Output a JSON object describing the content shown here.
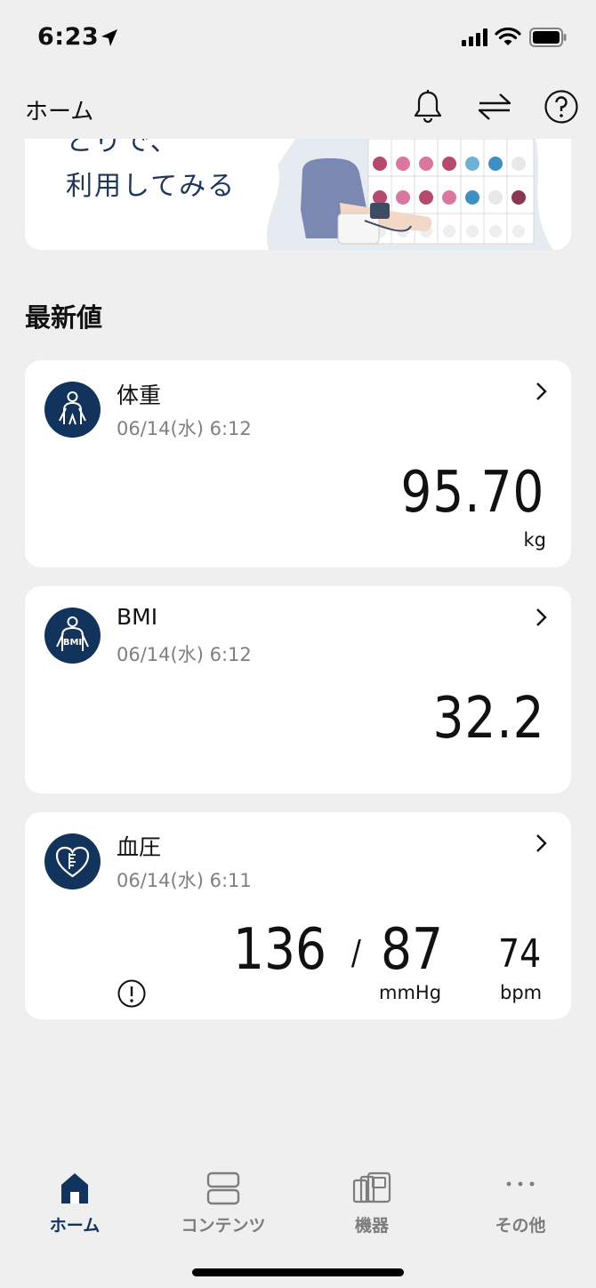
{
  "status": {
    "time": "6:23"
  },
  "header": {
    "title": "ホーム"
  },
  "banner": {
    "line_top": "とりで、",
    "line_main": "利用してみる"
  },
  "section": {
    "title": "最新値"
  },
  "cards": {
    "weight": {
      "title": "体重",
      "date": "06/14(水) 6:12",
      "value": "95.70",
      "unit": "kg",
      "icon": "person-icon"
    },
    "bmi": {
      "title": "BMI",
      "date": "06/14(水) 6:12",
      "value": "32.2",
      "icon": "bmi-person-icon"
    },
    "bp": {
      "title": "血圧",
      "date": "06/14(水) 6:11",
      "systolic": "136",
      "slash": "/",
      "diastolic": "87",
      "unit": "mmHg",
      "pulse": "74",
      "pulse_unit": "bpm",
      "icon": "heart-icon"
    }
  },
  "tabs": [
    {
      "label": "ホーム",
      "icon": "home-icon",
      "active": true
    },
    {
      "label": "コンテンツ",
      "icon": "contents-icon",
      "active": false
    },
    {
      "label": "機器",
      "icon": "devices-icon",
      "active": false
    },
    {
      "label": "その他",
      "icon": "more-icon",
      "active": false
    }
  ],
  "colors": {
    "brand": "#12345c",
    "background": "#efefef",
    "card": "#ffffff"
  }
}
